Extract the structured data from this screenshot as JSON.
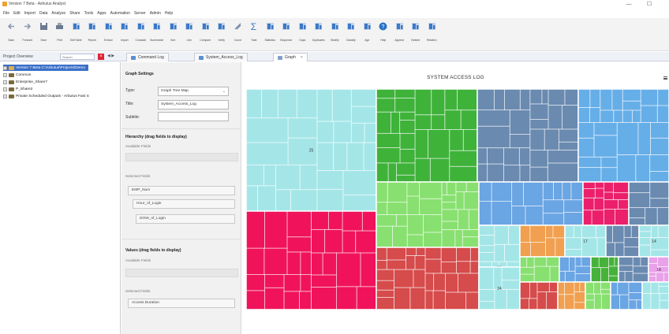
{
  "window": {
    "title": "Version 7 Beta - Ashulux Analyst",
    "minimize": "—",
    "maximize": "☐"
  },
  "menu": [
    "File",
    "Edit",
    "Import",
    "Data",
    "Analyze",
    "Share",
    "Tools",
    "Apps",
    "Automation",
    "Server",
    "Admin",
    "Help"
  ],
  "toolbar": [
    {
      "label": "Back",
      "icon": "arrow-left-icon",
      "color": "#8a9bb5"
    },
    {
      "label": "Forward",
      "icon": "arrow-right-icon",
      "color": "#8a9bb5"
    },
    {
      "label": "Save",
      "icon": "save-icon",
      "color": "#6b7a8f"
    },
    {
      "label": "Print",
      "icon": "print-icon",
      "color": "#6b7a8f"
    },
    {
      "label": "Edit Table",
      "icon": "edit-table-icon",
      "color": "#3b78c8"
    },
    {
      "label": "Report",
      "icon": "report-icon",
      "color": "#3b78c8"
    },
    {
      "label": "Extract",
      "icon": "extract-icon",
      "color": "#3b78c8"
    },
    {
      "label": "Import",
      "icon": "import-icon",
      "color": "#3b78c8"
    },
    {
      "label": "Crosstab",
      "icon": "crosstab-icon",
      "color": "#3b78c8"
    },
    {
      "label": "Summarize",
      "icon": "summarize-icon",
      "color": "#3b78c8"
    },
    {
      "label": "Sort",
      "icon": "sort-icon",
      "color": "#3b78c8"
    },
    {
      "label": "Join",
      "icon": "join-icon",
      "color": "#3b78c8"
    },
    {
      "label": "Compare",
      "icon": "compare-icon",
      "color": "#3b78c8"
    },
    {
      "label": "Verify",
      "icon": "verify-icon",
      "color": "#3b78c8"
    },
    {
      "label": "Count",
      "icon": "count-icon",
      "color": "#7a8aa8"
    },
    {
      "label": "Total",
      "icon": "total-icon",
      "color": "#3b78c8"
    },
    {
      "label": "Statistics",
      "icon": "statistics-icon",
      "color": "#3b78c8"
    },
    {
      "label": "Sequence",
      "icon": "sequence-icon",
      "color": "#3b78c8"
    },
    {
      "label": "Gaps",
      "icon": "gaps-icon",
      "color": "#3b78c8"
    },
    {
      "label": "Duplicates",
      "icon": "duplicates-icon",
      "color": "#3b78c8"
    },
    {
      "label": "Stratify",
      "icon": "stratify-icon",
      "color": "#3b78c8"
    },
    {
      "label": "Classify",
      "icon": "classify-icon",
      "color": "#3b78c8"
    },
    {
      "label": "Age",
      "icon": "age-icon",
      "color": "#3b78c8"
    },
    {
      "label": "Help",
      "icon": "help-icon",
      "color": "#2a72c8"
    },
    {
      "label": "Append",
      "icon": "append-icon",
      "color": "#3b78c8"
    },
    {
      "label": "Nested",
      "icon": "nested-icon",
      "color": "#3b78c8"
    },
    {
      "label": "Relation",
      "icon": "relation-icon",
      "color": "#3b78c8"
    }
  ],
  "project": {
    "label": "Project Overview",
    "search_placeholder": "Search",
    "close": "×",
    "nav": "◀ ▶",
    "tree": [
      {
        "label": "Version 7 Beta C:\\Arbutus\\Projects\\Demo",
        "selected": true,
        "light": true
      },
      {
        "label": "Common",
        "selected": false,
        "light": false
      },
      {
        "label": "Enterprise_Share7",
        "selected": false,
        "light": false
      },
      {
        "label": "P_Share2",
        "selected": false,
        "light": false
      },
      {
        "label": "Private Scheduled Outputs - Arbutus Fast S",
        "selected": false,
        "light": false
      }
    ]
  },
  "tabs": [
    {
      "label": "Command Log",
      "close": ""
    },
    {
      "label": "System_Access_Log",
      "close": ""
    },
    {
      "label": "Graph",
      "close": "×"
    }
  ],
  "settings": {
    "header": "Graph Settings",
    "type_label": "Type:",
    "type_value": "Graph Tree Map",
    "title_label": "Title:",
    "title_value": "System_Access_Log",
    "subtitle_label": "Subtitle:",
    "subtitle_value": "",
    "hierarchy_header": "Hierarchy (drag fields to display)",
    "available_fields": "Available Fields",
    "selected_fields": "Selected Fields",
    "hierarchy_fields": [
      "EMP_Num",
      "Hour_of_Login",
      "DOW_of_Login"
    ],
    "values_header": "Values (drag fields to display)",
    "values_available": "Available Fields",
    "values_selected": "Selected Fields",
    "values_fields": [
      "Access Duration"
    ]
  },
  "chart_data": {
    "type": "heatmap",
    "subtype": "treemap",
    "title": "SYSTEM ACCESS LOG",
    "groups": [
      {
        "label": "25",
        "color": "#a4e6e8"
      },
      {
        "label": "",
        "color": "#3fb23a"
      },
      {
        "label": "",
        "color": "#6a8ab0"
      },
      {
        "label": "",
        "color": "#66aee8"
      },
      {
        "label": "",
        "color": "#f0135c"
      },
      {
        "label": "",
        "color": "#88e070"
      },
      {
        "label": "",
        "color": "#d64b4b"
      },
      {
        "label": "",
        "color": "#6aa5e4"
      },
      {
        "label": "",
        "color": "#ec1f6b"
      },
      {
        "label": "",
        "color": "#6a8ab0"
      },
      {
        "label": "24",
        "color": "#a4e6e8"
      },
      {
        "label": "",
        "color": "#f0a050"
      },
      {
        "label": "17",
        "color": "#a4e6e8"
      },
      {
        "label": "",
        "color": "#6a8ab0"
      },
      {
        "label": "14",
        "color": "#a4e6e8"
      },
      {
        "label": "24",
        "color": "#a4e6e8"
      },
      {
        "label": "",
        "color": "#88e070"
      },
      {
        "label": "",
        "color": "#6aa5e4"
      },
      {
        "label": "",
        "color": "#46b23a"
      },
      {
        "label": "",
        "color": "#6a8ab0"
      },
      {
        "label": "14",
        "color": "#e8a2e8"
      },
      {
        "label": "",
        "color": "#d64b4b"
      },
      {
        "label": "",
        "color": "#f0a050"
      },
      {
        "label": "",
        "color": "#88e070"
      },
      {
        "label": "",
        "color": "#6aa5e4"
      },
      {
        "label": "",
        "color": "#a4e6e8"
      }
    ]
  }
}
